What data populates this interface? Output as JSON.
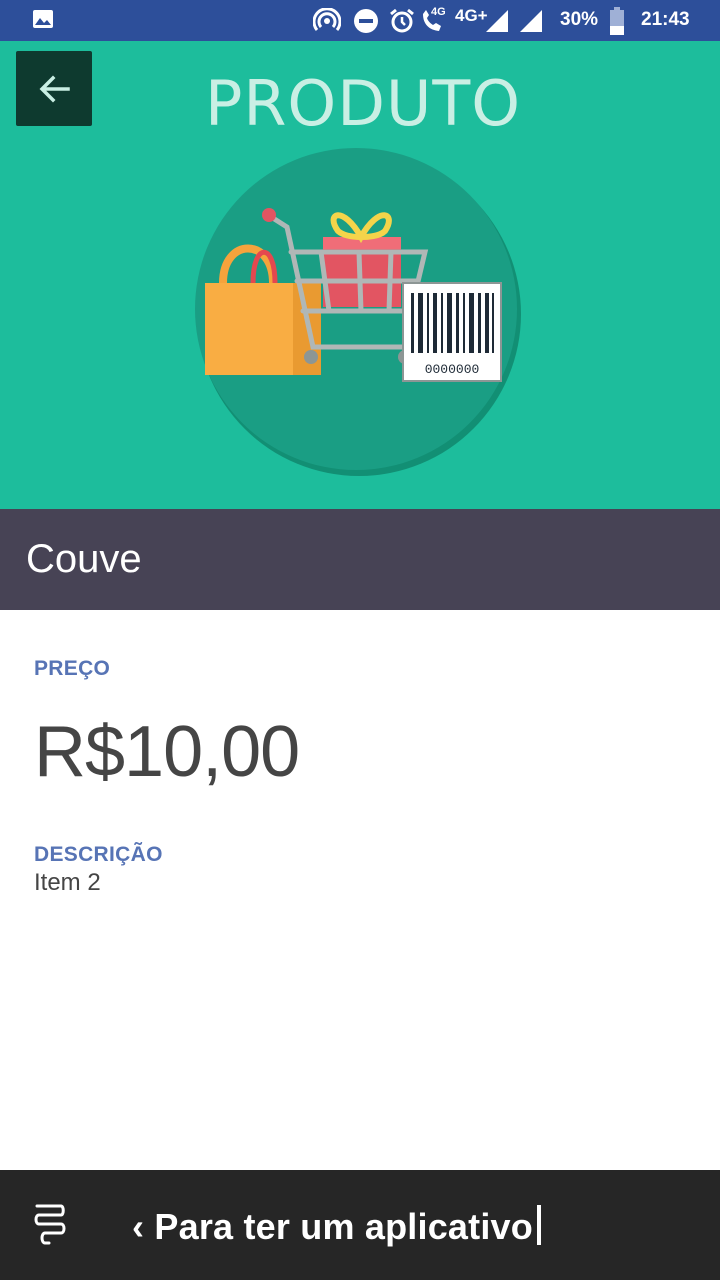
{
  "status_bar": {
    "network_small": "4G",
    "network": "4G+",
    "battery": "30%",
    "time": "21:43"
  },
  "header": {
    "title": "PRODUTO",
    "barcode_digits": "0000000"
  },
  "product": {
    "name": "Couve"
  },
  "details": {
    "price_label": "PREÇO",
    "price_value": "R$10,00",
    "description_label": "DESCRIÇÃO",
    "description_value": "Item 2"
  },
  "promo_bar": {
    "text": "‹ Para ter um aplicativo"
  },
  "colors": {
    "status_bar": "#2d4f9a",
    "header": "#1dbd9c",
    "name_bar": "#474355",
    "label": "#5774b5",
    "promo_bar": "#262626"
  }
}
